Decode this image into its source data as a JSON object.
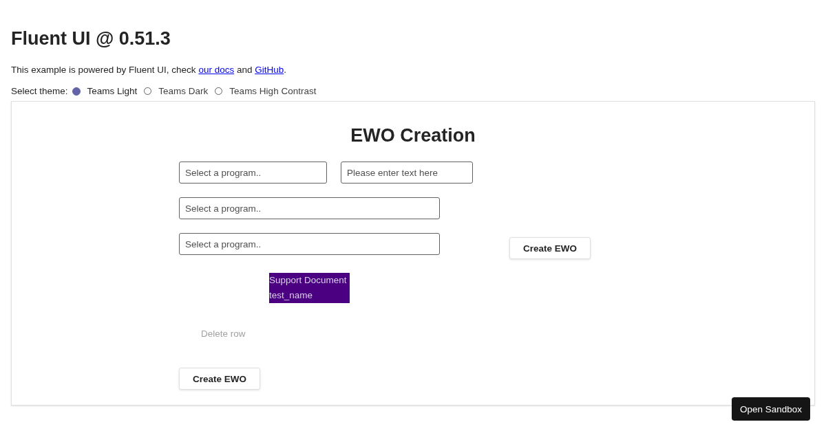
{
  "title": "Fluent UI @ 0.51.3",
  "intro": {
    "before": "This example is powered by Fluent UI, check ",
    "link1": "our docs",
    "middle": " and ",
    "link2": "GitHub",
    "after": "."
  },
  "theme": {
    "label": "Select theme:",
    "options": [
      {
        "label": "Teams Light",
        "selected": true
      },
      {
        "label": "Teams Dark",
        "selected": false
      },
      {
        "label": "Teams High Contrast",
        "selected": false
      }
    ]
  },
  "form": {
    "title": "EWO Creation",
    "row1": [
      {
        "placeholder": "Select a program.."
      },
      {
        "placeholder": "Please enter text here"
      }
    ],
    "row2": {
      "placeholder": "Select a program.."
    },
    "row3": {
      "placeholder": "Select a program.."
    },
    "side_button": "Create EWO",
    "document": {
      "label": "Support Document",
      "name": "test_name"
    },
    "delete_button": {
      "label": "Delete row",
      "disabled": true
    },
    "submit_button": "Create EWO"
  },
  "sandbox_button": "Open Sandbox"
}
